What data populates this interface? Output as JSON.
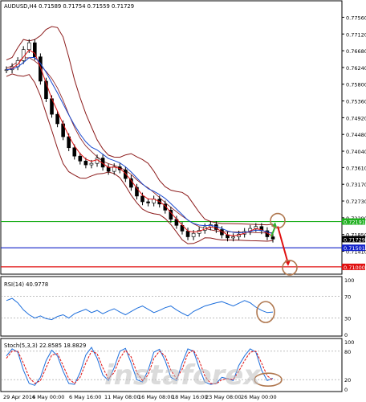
{
  "chart_data": [
    {
      "type": "line",
      "title": "AUDUSD,H4 0.71589 0.71754 0.71559 0.71729",
      "symbol": "AUDUSD,H4",
      "ohlc": {
        "open": 0.71589,
        "high": 0.71754,
        "low": 0.71559,
        "close": 0.71729
      },
      "y_ticks": [
        "0.77560",
        "0.77120",
        "0.76680",
        "0.76240",
        "0.75800",
        "0.75360",
        "0.74920",
        "0.74480",
        "0.74040",
        "0.73610",
        "0.73170",
        "0.72730",
        "0.72290",
        "0.71850",
        "0.71410"
      ],
      "ylim": [
        0.7085,
        0.7795
      ],
      "x_ticks": [
        "29 Apr 2016",
        "4 May 00:00",
        "6 May 16:00",
        "11 May 08:00",
        "16 May 08:00",
        "18 May 16:00",
        "23 May 08:00",
        "26 May 00:00"
      ],
      "series": [
        {
          "values": [
            0.7618,
            0.7626,
            0.7642,
            0.7671,
            0.7689,
            0.7652,
            0.7588,
            0.7542,
            0.7501,
            0.7476,
            0.7442,
            0.7413,
            0.7391,
            0.7378,
            0.7368,
            0.7372,
            0.7386,
            0.7362,
            0.7351,
            0.7363,
            0.7355,
            0.7332,
            0.7309,
            0.7286,
            0.7271,
            0.7268,
            0.7278,
            0.7265,
            0.7249,
            0.7225,
            0.7209,
            0.7194,
            0.7179,
            0.7188,
            0.7196,
            0.7205,
            0.7211,
            0.7198,
            0.7184,
            0.7176,
            0.7179,
            0.7186,
            0.7193,
            0.7201,
            0.7206,
            0.7195,
            0.7179,
            0.7173
          ]
        }
      ],
      "levels": [
        {
          "label": "0.72191",
          "value": 0.72191,
          "color": "#20b020"
        },
        {
          "label": "0.71501",
          "value": 0.71501,
          "color": "#1020c8"
        },
        {
          "label": "0.71000",
          "value": 0.71,
          "color": "#e01010"
        }
      ],
      "price_tag": "0.71729"
    },
    {
      "type": "line",
      "title": "RSI(14) 40.9778",
      "ylim": [
        0,
        100
      ],
      "y_ticks": [
        "100",
        "70",
        "30",
        "0"
      ],
      "series": [
        {
          "values": [
            62,
            66,
            58,
            45,
            36,
            30,
            34,
            29,
            27,
            33,
            36,
            30,
            38,
            42,
            46,
            40,
            44,
            38,
            43,
            47,
            41,
            36,
            42,
            48,
            52,
            46,
            40,
            44,
            49,
            52,
            45,
            39,
            34,
            42,
            47,
            52,
            55,
            58,
            60,
            56,
            52,
            57,
            62,
            58,
            50,
            44,
            40,
            41
          ]
        }
      ]
    },
    {
      "type": "line",
      "title": "Stoch(5,3,3) 22.8585 18.8829",
      "ylim": [
        0,
        100
      ],
      "y_ticks": [
        "100",
        "80",
        "20",
        "0"
      ],
      "series": [
        {
          "values": [
            70,
            85,
            78,
            40,
            12,
            8,
            25,
            60,
            82,
            70,
            38,
            12,
            10,
            35,
            72,
            88,
            65,
            30,
            18,
            45,
            80,
            86,
            55,
            20,
            15,
            40,
            78,
            84,
            60,
            25,
            18,
            55,
            85,
            80,
            45,
            15,
            10,
            12,
            25,
            22,
            18,
            50,
            70,
            85,
            78,
            40,
            18,
            23
          ]
        },
        {
          "values": [
            65,
            80,
            80,
            55,
            25,
            12,
            18,
            45,
            72,
            75,
            50,
            22,
            12,
            25,
            55,
            80,
            75,
            45,
            22,
            35,
            65,
            82,
            68,
            35,
            18,
            30,
            65,
            80,
            70,
            40,
            22,
            42,
            75,
            82,
            60,
            28,
            12,
            11,
            20,
            22,
            20,
            38,
            60,
            78,
            80,
            55,
            28,
            19
          ]
        }
      ]
    }
  ],
  "watermark": "instaforex"
}
